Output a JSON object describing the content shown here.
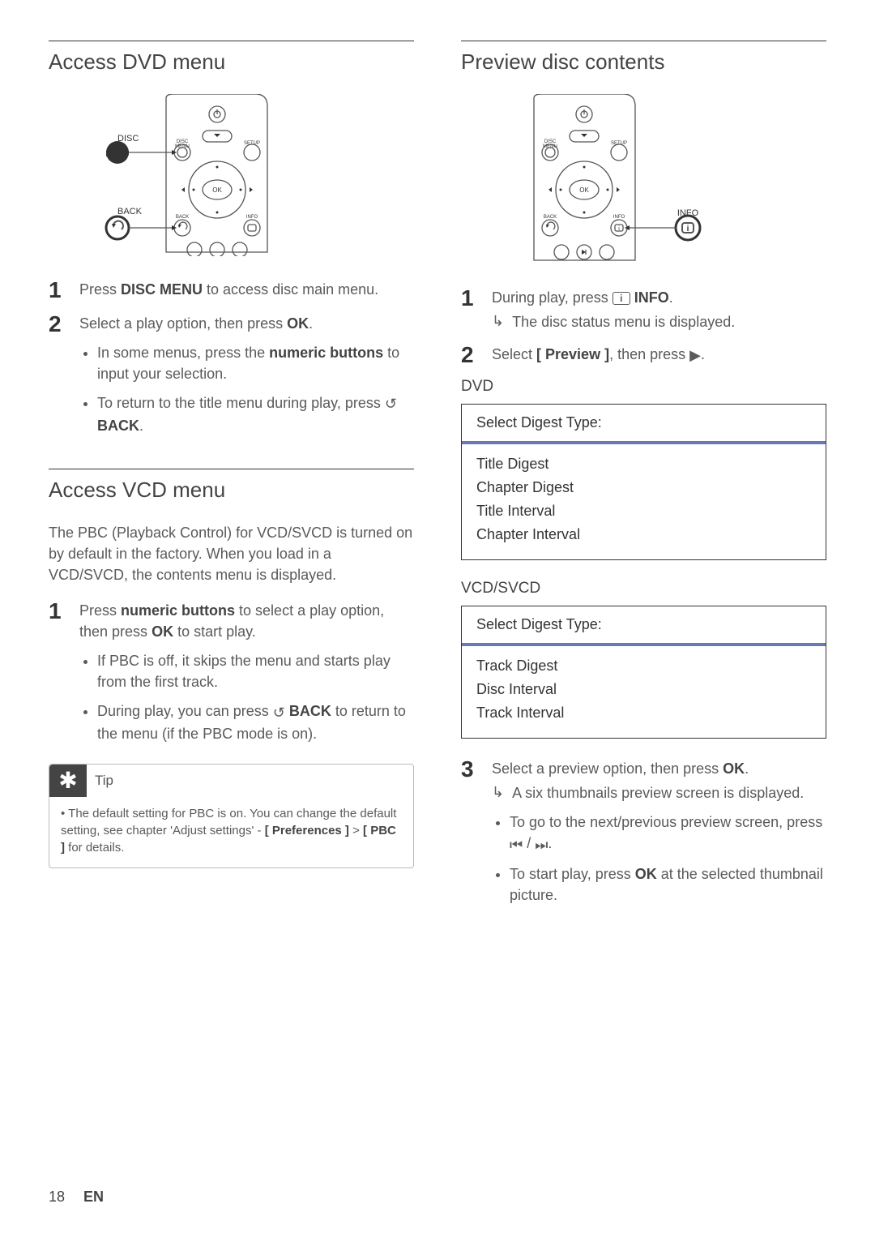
{
  "left": {
    "sec1": {
      "title": "Access DVD menu",
      "labels": {
        "disc_menu": "DISC MENU",
        "back": "BACK"
      },
      "step1": {
        "pre": "Press ",
        "bold": "DISC MENU",
        "post": " to access disc main menu."
      },
      "step2": {
        "pre": "Select a play option, then press ",
        "bold": "OK",
        "post": ".",
        "bul1": {
          "pre": "In some menus, press the ",
          "bold": "numeric buttons",
          "post": " to input your selection."
        },
        "bul2": {
          "pre": "To return to the title menu during play, press ",
          "icon": "↺",
          "bold": " BACK",
          "post": "."
        }
      }
    },
    "sec2": {
      "title": "Access VCD menu",
      "intro": "The PBC (Playback Control) for VCD/SVCD is turned on by default in the factory. When you load in a VCD/SVCD, the contents menu is displayed.",
      "step1": {
        "pre": "Press ",
        "bold": "numeric buttons",
        "mid": " to select a play option, then press ",
        "bold2": "OK",
        "post": " to start play.",
        "bul1": "If PBC is off, it skips the menu and starts play from the first track.",
        "bul2": {
          "pre": "During play, you can press ",
          "icon": "↺",
          "bold": " BACK",
          "post": " to return to the menu (if the PBC mode is on)."
        }
      },
      "tip": {
        "label": "Tip",
        "body": {
          "pre": "The default setting for PBC is on. You can change the default setting, see chapter 'Adjust settings' - ",
          "b1": "[ Preferences ]",
          "mid": " > ",
          "b2": "[ PBC ]",
          "post": " for details."
        }
      }
    }
  },
  "right": {
    "title": "Preview disc contents",
    "labels": {
      "info": "INFO"
    },
    "step1": {
      "pre": "During play, press ",
      "iconbox": "i",
      "bold": " INFO",
      "post": ".",
      "res": "The disc status menu is displayed."
    },
    "step2": {
      "pre": "Select ",
      "bold": "[ Preview ]",
      "mid": ", then press ",
      "icon": "▶",
      "post": "."
    },
    "dvd": {
      "label": "DVD",
      "hdr": "Select Digest Type:",
      "items": [
        "Title Digest",
        "Chapter Digest",
        "Title Interval",
        "Chapter Interval"
      ]
    },
    "vcd": {
      "label": "VCD/SVCD",
      "hdr": "Select Digest Type:",
      "items": [
        "Track Digest",
        "Disc Interval",
        "Track Interval"
      ]
    },
    "step3": {
      "pre": "Select a preview option, then press ",
      "bold": "OK",
      "post": ".",
      "res": "A six thumbnails preview screen is displayed.",
      "bul1": {
        "pre": "To go to the next/previous preview screen, press ",
        "i1": "⏮",
        "sep": " / ",
        "i2": "⏭",
        "post": "."
      },
      "bul2": {
        "pre": "To start play, press ",
        "bold": "OK",
        "post": " at the selected thumbnail picture."
      }
    }
  },
  "footer": {
    "page": "18",
    "lang": "EN"
  }
}
